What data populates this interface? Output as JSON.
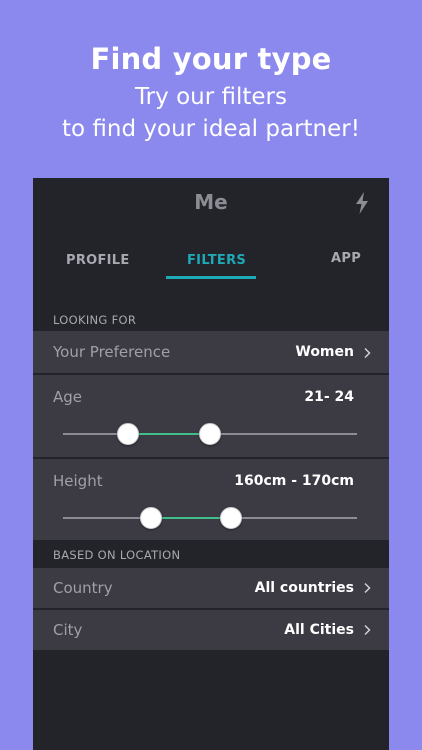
{
  "promo": {
    "title": "Find your type",
    "subtitle_line1": "Try our filters",
    "subtitle_line2": "to find your ideal partner!"
  },
  "header": {
    "title": "Me",
    "action_icon": "lightning-bolt-icon"
  },
  "tabs": [
    {
      "label": "PROFILE",
      "active": false
    },
    {
      "label": "FILTERS",
      "active": true
    },
    {
      "label": "APP",
      "active": false
    }
  ],
  "sections": {
    "looking_for": "LOOKING FOR",
    "based_on_location": "BASED ON LOCATION"
  },
  "filters": {
    "preference": {
      "label": "Your Preference",
      "value": "Women"
    },
    "age": {
      "label": "Age",
      "value": "21- 24",
      "range_low_fraction": 0.22,
      "range_high_fraction": 0.5
    },
    "height": {
      "label": "Height",
      "value": "160cm - 170cm",
      "range_low_fraction": 0.3,
      "range_high_fraction": 0.57
    },
    "country": {
      "label": "Country",
      "value": "All countries"
    },
    "city": {
      "label": "City",
      "value": "All Cities"
    }
  },
  "colors": {
    "background": "#8B88EE",
    "panel": "#23232A",
    "row": "#3C3A42",
    "accent": "#1EA9B6",
    "slider_fill": "#3FBE8C"
  }
}
